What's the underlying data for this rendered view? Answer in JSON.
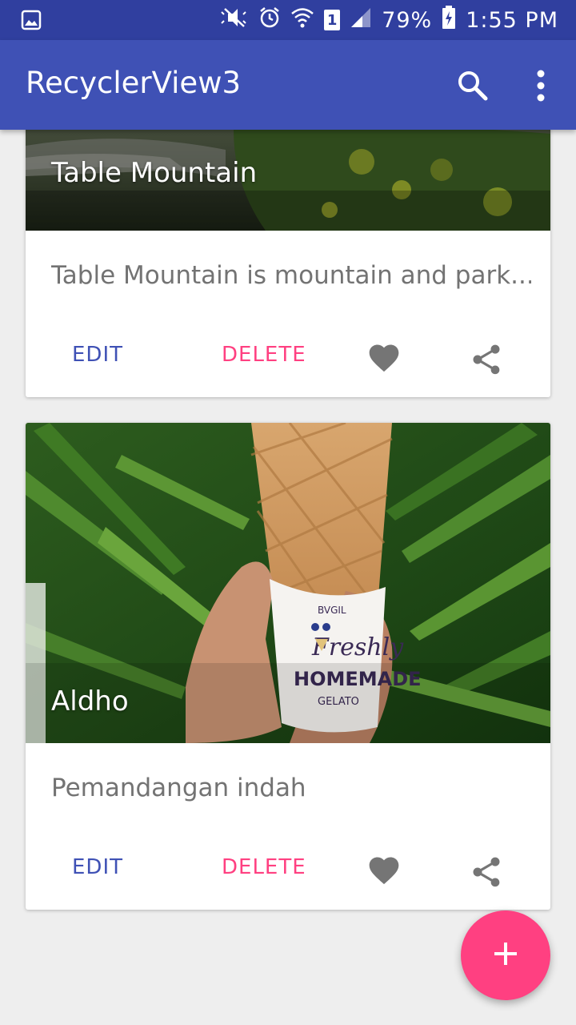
{
  "status_bar": {
    "battery": "79%",
    "time": "1:55 PM",
    "sim": "1",
    "icons": [
      "gallery-icon",
      "mute-icon",
      "alarm-icon",
      "wifi-icon",
      "signal-icon",
      "battery-charging-icon"
    ]
  },
  "app_bar": {
    "title": "RecyclerView3",
    "icons": [
      "search-icon",
      "more-vert-icon"
    ]
  },
  "cards": [
    {
      "title": "Table Mountain",
      "description": "Table Mountain is mountain and park...",
      "edit_label": "EDIT",
      "delete_label": "DELETE",
      "icons": [
        "favorite-icon",
        "share-icon"
      ]
    },
    {
      "title": "Aldho",
      "description": "Pemandangan indah",
      "edit_label": "EDIT",
      "delete_label": "DELETE",
      "icons": [
        "favorite-icon",
        "share-icon"
      ]
    }
  ],
  "fab": {
    "icon": "add-icon"
  },
  "colors": {
    "primary": "#3f51b5",
    "primary_dark": "#303f9f",
    "accent": "#ff4081",
    "icon_gray": "#757575"
  }
}
